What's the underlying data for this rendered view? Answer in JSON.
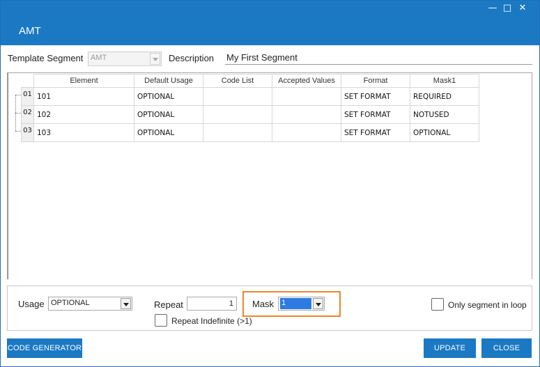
{
  "window": {
    "title": "AMT"
  },
  "header": {
    "template_segment_label": "Template Segment",
    "template_segment_value": "AMT",
    "description_label": "Description",
    "description_value": "My First Segment"
  },
  "grid": {
    "columns": [
      "Element",
      "Default Usage",
      "Code List",
      "Accepted Values",
      "Format",
      "Mask1"
    ],
    "rows": [
      {
        "num": "01",
        "cells": [
          "101",
          "OPTIONAL",
          "",
          "",
          "SET FORMAT",
          "REQUIRED"
        ]
      },
      {
        "num": "02",
        "cells": [
          "102",
          "OPTIONAL",
          "",
          "",
          "SET FORMAT",
          "NOTUSED"
        ]
      },
      {
        "num": "03",
        "cells": [
          "103",
          "OPTIONAL",
          "",
          "",
          "SET FORMAT",
          "OPTIONAL"
        ]
      }
    ]
  },
  "options": {
    "usage_label": "Usage",
    "usage_value": "OPTIONAL",
    "repeat_label": "Repeat",
    "repeat_value": "1",
    "mask_label": "Mask",
    "mask_value": "1",
    "repeat_indefinite_label": "Repeat Indefinite (>1)",
    "only_segment_label": "Only segment in loop"
  },
  "buttons": {
    "code_generator": "CODE GENERATOR",
    "update": "UPDATE",
    "close": "CLOSE"
  },
  "colors": {
    "accent": "#1b79c4",
    "highlight": "#f0832a",
    "selection": "#2d7be0"
  },
  "icons": [
    "minimize-icon",
    "maximize-icon",
    "close-icon",
    "dropdown-arrow-icon"
  ]
}
